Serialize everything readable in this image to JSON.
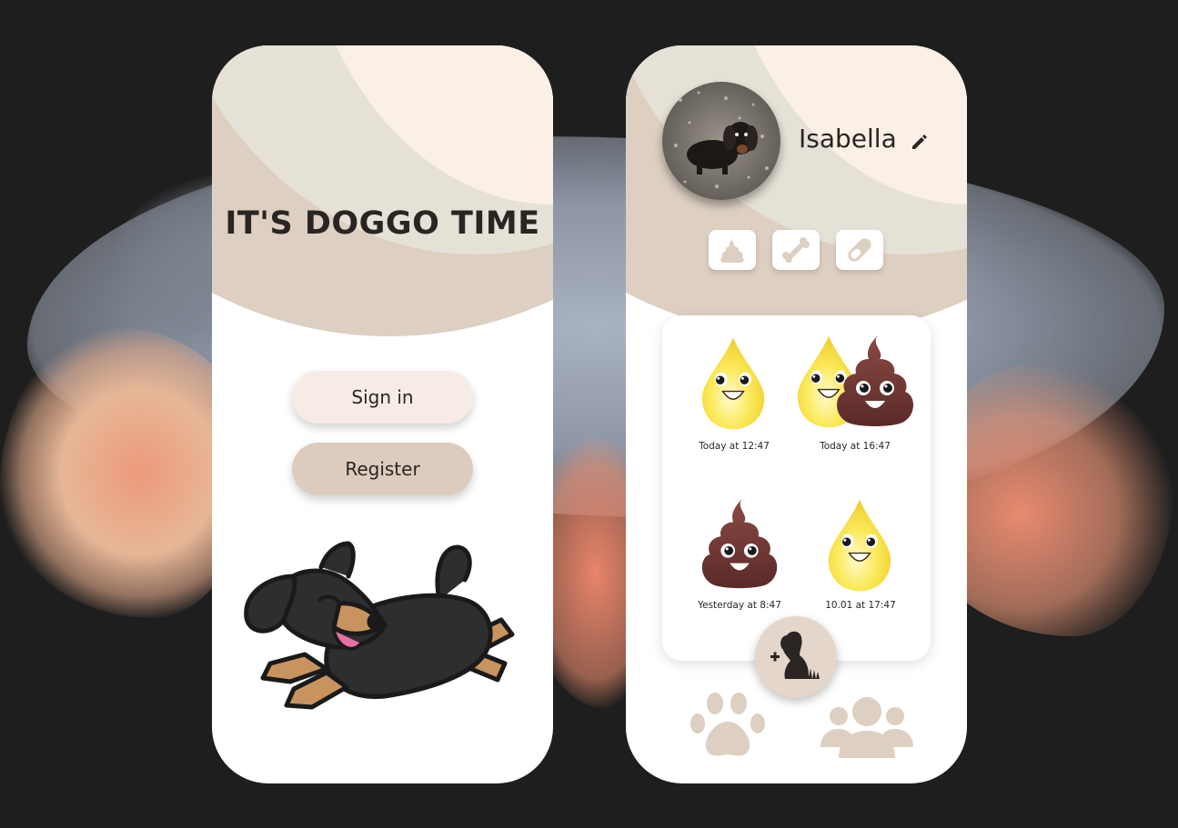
{
  "colors": {
    "background": "#1e1e1e",
    "cream": "#faf0e6",
    "grey_beige": "#e6e1d6",
    "beige": "#ddcfc2",
    "accent_beige": "#ddccbe",
    "text": "#2a2522"
  },
  "login": {
    "title": "IT'S DOGGO TIME",
    "signin_label": "Sign in",
    "register_label": "Register",
    "illustration": "dachshund-illustration"
  },
  "profile": {
    "name": "Isabella",
    "avatar": "dog-photo-avatar",
    "edit_icon": "pencil-icon",
    "categories": [
      {
        "name": "poop",
        "icon": "poop-icon"
      },
      {
        "name": "food",
        "icon": "bone-icon"
      },
      {
        "name": "medicine",
        "icon": "pill-icon"
      }
    ],
    "entries": [
      {
        "type": "pee",
        "time": "Today at 12:47"
      },
      {
        "type": "pee+poop",
        "time": "Today at 16:47"
      },
      {
        "type": "poop",
        "time": "Yesterday at 8:47"
      },
      {
        "type": "pee",
        "time": "10.01 at 17:47"
      }
    ],
    "fab_icon": "add-dog-icon",
    "nav": [
      {
        "name": "paw",
        "icon": "paw-icon"
      },
      {
        "name": "group",
        "icon": "group-icon"
      }
    ]
  }
}
